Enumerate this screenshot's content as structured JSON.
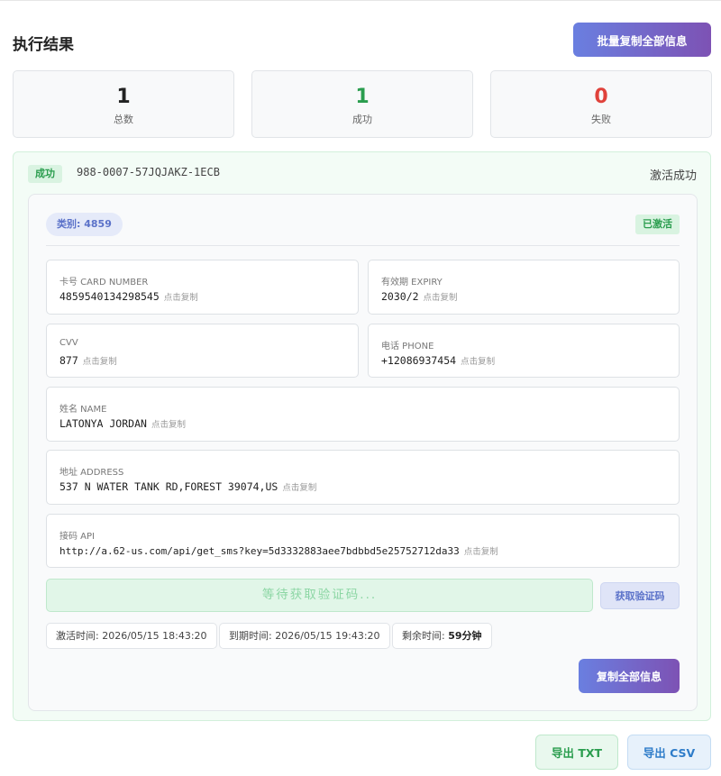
{
  "header": {
    "title": "执行结果",
    "batch_copy_label": "批量复制全部信息"
  },
  "stats": {
    "total": {
      "value": "1",
      "label": "总数",
      "color": "#222222"
    },
    "success": {
      "value": "1",
      "label": "成功",
      "color": "#2a9d4e"
    },
    "failed": {
      "value": "0",
      "label": "失败",
      "color": "#e0423b"
    }
  },
  "result": {
    "badge": "成功",
    "code": "988-0007-57JQJAKZ-1ECB",
    "status": "激活成功",
    "category": "类别: 4859",
    "activated_badge": "已激活",
    "copy_hint": "点击复制",
    "fields": {
      "card_number": {
        "label": "卡号 CARD NUMBER",
        "value": "4859540134298545"
      },
      "expiry": {
        "label": "有效期 EXPIRY",
        "value": "2030/2"
      },
      "cvv": {
        "label": "CVV",
        "value": "877"
      },
      "phone": {
        "label": "电话 PHONE",
        "value": "+12086937454"
      },
      "name": {
        "label": "姓名 NAME",
        "value": "LATONYA JORDAN"
      },
      "address": {
        "label": "地址 ADDRESS",
        "value": "537 N WATER TANK RD,FOREST 39074,US"
      },
      "api": {
        "label": "接码 API",
        "value": "http://a.62-us.com/api/get_sms?key=5d3332883aee7bdbbd5e25752712da33"
      }
    },
    "sms_waiting": "等待获取验证码...",
    "get_code_label": "获取验证码",
    "times": {
      "activated_label": "激活时间:",
      "activated_value": "2026/05/15 18:43:20",
      "expires_label": "到期时间:",
      "expires_value": "2026/05/15 19:43:20",
      "remaining_label": "剩余时间:",
      "remaining_value": "59分钟"
    },
    "copy_all_label": "复制全部信息"
  },
  "export": {
    "txt_label": "导出 TXT",
    "csv_label": "导出 CSV"
  }
}
